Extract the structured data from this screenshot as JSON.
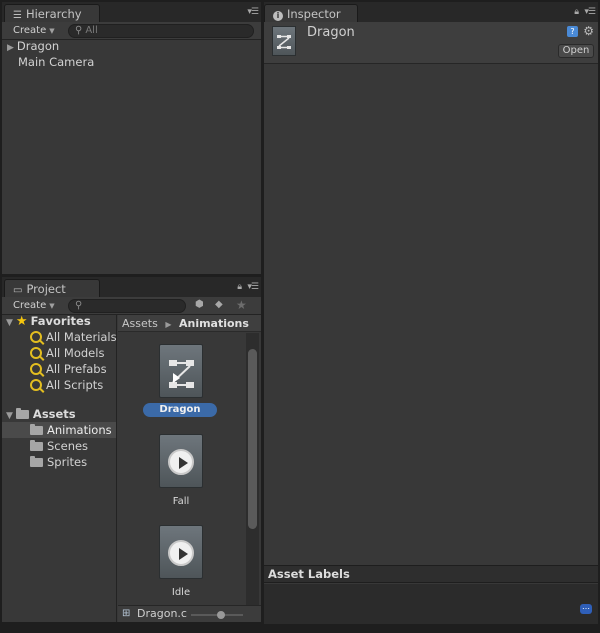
{
  "hierarchy": {
    "tab_label": "Hierarchy",
    "create_label": "Create",
    "search_placeholder": "All",
    "items": [
      {
        "label": "Dragon",
        "collapsed": true
      },
      {
        "label": "Main Camera"
      }
    ]
  },
  "inspector": {
    "tab_label": "Inspector",
    "object_name": "Dragon",
    "open_label": "Open",
    "asset_labels_title": "Asset Labels"
  },
  "project": {
    "tab_label": "Project",
    "create_label": "Create",
    "favorites": {
      "label": "Favorites",
      "items": [
        "All Materials",
        "All Models",
        "All Prefabs",
        "All Scripts"
      ]
    },
    "assets": {
      "label": "Assets",
      "folders": [
        "Animations",
        "Scenes",
        "Sprites"
      ],
      "selected_folder": "Animations"
    },
    "breadcrumb": {
      "root": "Assets",
      "current": "Animations"
    },
    "files": [
      {
        "name": "Dragon",
        "kind": "animator-controller",
        "selected": true
      },
      {
        "name": "Fall",
        "kind": "animation-clip"
      },
      {
        "name": "Idle",
        "kind": "animation-clip"
      }
    ],
    "status_file": "Dragon.c",
    "colors": {
      "selection": "#3b6aa8",
      "favorite_star": "#f6c60e"
    }
  }
}
